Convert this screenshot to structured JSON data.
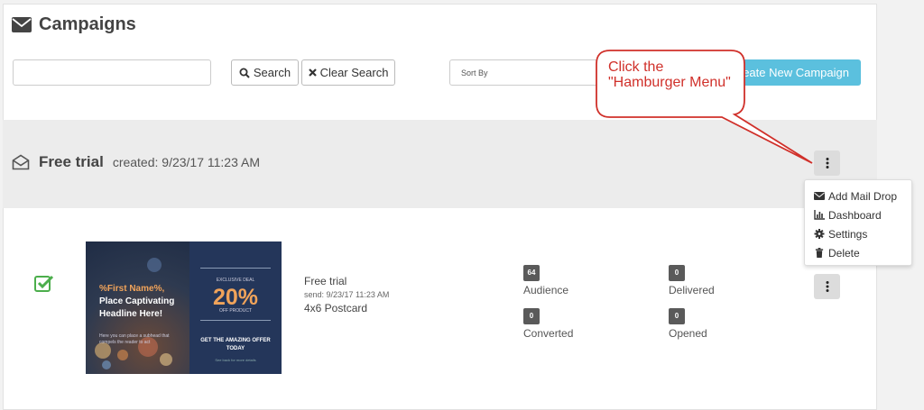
{
  "header": {
    "title": "Campaigns"
  },
  "toolbar": {
    "search_value": "",
    "search_label": "Search",
    "clear_label": "Clear Search",
    "sort_placeholder": "Sort By",
    "create_label": "Create New Campaign"
  },
  "campaign": {
    "name": "Free trial",
    "created": "created: 9/23/17 11:23 AM"
  },
  "menu": {
    "items": [
      {
        "label": "Add Mail Drop",
        "icon": "envelope-icon"
      },
      {
        "label": "Dashboard",
        "icon": "bar-chart-icon"
      },
      {
        "label": "Settings",
        "icon": "gear-icon"
      },
      {
        "label": "Delete",
        "icon": "trash-icon"
      }
    ]
  },
  "mail_drop": {
    "name": "Free trial",
    "send": "send: 9/23/17 11:23 AM",
    "type": "4x6 Postcard",
    "thumbnail": {
      "headline_a": "%First Name%,",
      "headline_b": "Place Captivating Headline Here!",
      "small_text": "Here you can place a subhead that compels the reader to act",
      "deal": "EXCLUSIVE DEAL",
      "percent": "20%",
      "off": "OFF PRODUCT",
      "cta": "GET THE AMAZING OFFER TODAY",
      "link": "See back for more details"
    },
    "stats": [
      {
        "value": "64",
        "label": "Audience"
      },
      {
        "value": "0",
        "label": "Delivered"
      },
      {
        "value": "0",
        "label": "Converted"
      },
      {
        "value": "0",
        "label": "Opened"
      }
    ]
  },
  "annotation": {
    "text": "Click the \"Hamburger Menu\""
  },
  "colors": {
    "accent": "#5bc0de",
    "badge": "#5a5a5a",
    "callout": "#d0302a",
    "check": "#4cae4c",
    "band": "#ececec"
  }
}
